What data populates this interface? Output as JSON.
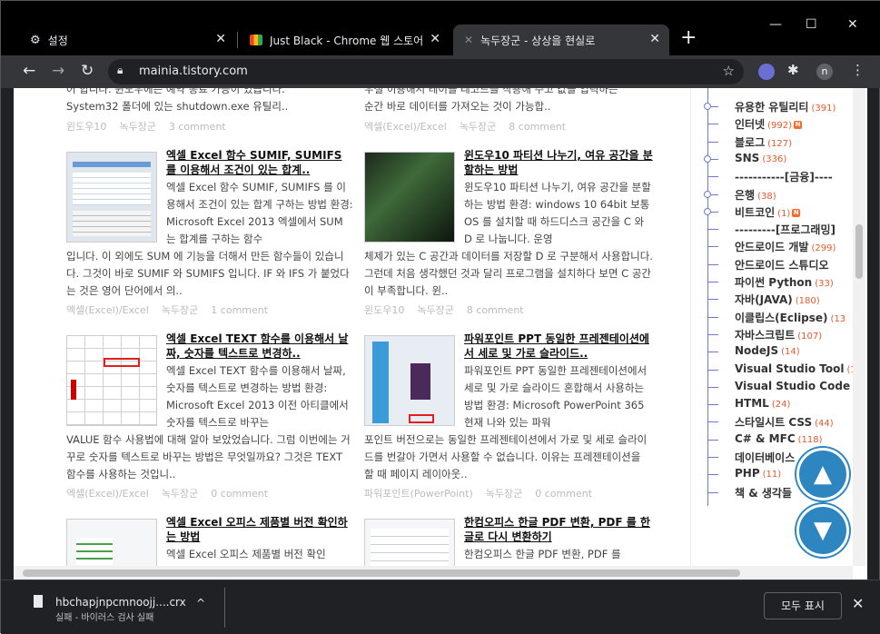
{
  "tabs": [
    {
      "title": "설정",
      "icon": "gear-icon"
    },
    {
      "title": "Just Black - Chrome 웹 스토어",
      "icon": "webstore-icon"
    },
    {
      "title": "녹두장군 - 상상을 현실로",
      "icon": "blog-icon"
    }
  ],
  "newtab_glyph": "+",
  "window_controls": {
    "minimize": "—",
    "maximize": "☐",
    "close": "✕"
  },
  "toolbar": {
    "back": "←",
    "forward": "→",
    "reload": "↻",
    "url": "mainia.tistory.com",
    "star": "☆",
    "profile_initial": "n",
    "menu": "⋮"
  },
  "content": {
    "top_left_line1": "어 합니다. 윈도우에는 예약 종료 가능이 있습니다.",
    "top_left_line2": "System32 폴더에 있는 shutdown.exe 유틸리..",
    "top_left_meta": [
      "윈도우10",
      "녹두장군",
      "3 comment"
    ],
    "top_right_line1": "우절 이용해서 테이블 레코드를 작용해 주고 값을 입력하는",
    "top_right_line2": "순간 바로 데이터를 가져오는 것이 가능합..",
    "top_right_meta": [
      "엑셀(Excel)/Excel",
      "녹두장군",
      "8 comment"
    ],
    "posts": [
      {
        "title": "엑셀 Excel 함수 SUMIF, SUMIFS 를 이용해서 조건이 있는 합계..",
        "body": "엑셀 Excel 함수 SUMIF, SUMIFS 를 이용해서 조건이 있는 합계 구하는 방법 환경: Microsoft Excel 2013 엑셀에서 SUM 는 합계를 구하는 함수",
        "body_wide": "입니다. 이 외에도 SUM 에 기능을 더해서 만든 함수들이 있습니다. 그것이 바로 SUMIF 와 SUMIFS 입니다. IF 와 IFS 가 붙었다는 것은 영어 단어에서 의..",
        "meta": [
          "엑셀(Excel)/Excel",
          "녹두장군",
          "1 comment"
        ]
      },
      {
        "title": "윈도우10 파티션 나누기, 여유 공간을 분할하는 방법",
        "body": "윈도우10 파티션 나누기, 여유 공간을 분할하는 방법 환경: windows 10 64bit 보통 OS 를 설치할 때 하드디스크 공간을 C 와 D 로 나눕니다. 운영",
        "body_wide": "체제가 있는 C 공간과 데이터를 저장할 D 로 구분해서 사용합니다. 그런데 처음 생각했던 것과 달리 프로그램을 설치하다 보면 C 공간이 부족합니다. 윈..",
        "meta": [
          "윈도우10",
          "녹두장군",
          "8 comment"
        ]
      },
      {
        "title": "엑셀 Excel TEXT 함수를 이용해서 날짜, 숫자를 텍스트로 변경하..",
        "body": "엑셀 Excel TEXT 함수를 이용해서 날짜, 숫자를 텍스트로 변경하는 방법 환경: Microsoft Excel 2013 이전 아티클에서 숫자를 텍스트로 바꾸는",
        "body_wide": "VALUE 함수 사용법에 대해 알아 보았었습니다. 그럼 이번에는 거꾸로 숫자를 텍스트로 바꾸는 방법은 무엇일까요? 그것은 TEXT 함수를 사용하는 것입니..",
        "meta": [
          "엑셀(Excel)/Excel",
          "녹두장군",
          "0 comment"
        ]
      },
      {
        "title": "파워포인트 PPT 동일한 프레젠테이션에서 세로 및 가로 슬라이드..",
        "body": "파워포인트 PPT 동일한 프레젠테이션에서 세로 및 가로 슬라이드 혼합해서 사용하는 방법 환경: Microsoft PowerPoint 365 현재 나와 있는 파워",
        "body_wide": "포인트 버전으로는 동일한 프레젠테이션에서 가로 및 세로 슬라이드를 번갈아 가면서 사용할 수 없습니다. 이유는 프레젠테이션을 할 때 페이지 레이아웃..",
        "meta": [
          "파워포인트(PowerPoint)",
          "녹두장군",
          "0 comment"
        ]
      },
      {
        "title": "엑셀 Excel 오피스 제품별 버전 확인하는 방법",
        "body": "엑셀 Excel 오피스 제품별 버전 확인",
        "body_wide": "",
        "meta": []
      },
      {
        "title": "한컴오피스 한글 PDF 변환, PDF 를 한글로 다시 변환하기",
        "body": "한컴오피스 한글 PDF 변환, PDF 를",
        "body_wide": "",
        "meta": []
      }
    ]
  },
  "sidebar": {
    "items": [
      {
        "label": "유용한 유틸리티",
        "count": "(391)",
        "new": false
      },
      {
        "label": "인터넷",
        "count": "(992)",
        "new": true
      },
      {
        "label": "블로그",
        "count": "(127)",
        "new": false
      },
      {
        "label": "SNS",
        "count": "(336)",
        "new": false
      },
      {
        "label": "-----------[금융]----",
        "count": "",
        "new": false
      },
      {
        "label": "은행",
        "count": "(38)",
        "new": false
      },
      {
        "label": "비트코인",
        "count": "(1)",
        "new": true
      },
      {
        "label": "---------[프로그래밍]",
        "count": "",
        "new": false
      },
      {
        "label": "안드로이드 개발",
        "count": "(299)",
        "new": false
      },
      {
        "label": "안드로이드 스튜디오",
        "count": "",
        "new": false
      },
      {
        "label": "파이썬 Python",
        "count": "(33)",
        "new": false
      },
      {
        "label": "자바(JAVA)",
        "count": "(180)",
        "new": false
      },
      {
        "label": "이클립스(Eclipse)",
        "count": "(13",
        "new": false
      },
      {
        "label": "자바스크립트",
        "count": "(107)",
        "new": false
      },
      {
        "label": "NodeJS",
        "count": "(14)",
        "new": false
      },
      {
        "label": "Visual Studio Tool",
        "count": "(1",
        "new": false
      },
      {
        "label": "Visual Studio Code",
        "count": "(",
        "new": false
      },
      {
        "label": "HTML",
        "count": "(24)",
        "new": false
      },
      {
        "label": "스타일시트 CSS",
        "count": "(44)",
        "new": false
      },
      {
        "label": "C# & MFC",
        "count": "(118)",
        "new": false
      },
      {
        "label": "데이터베이스",
        "count": "",
        "new": false
      },
      {
        "label": "PHP",
        "count": "(11)",
        "new": false
      },
      {
        "label": "책 & 생각들",
        "count": "",
        "new": false
      }
    ],
    "new_badge": "N"
  },
  "scroll_buttons": {
    "up": "▲",
    "down": "▼"
  },
  "download": {
    "filename": "hbchapjnpcmnoojj....crx",
    "status": "실패 - 바이러스 검사 실패",
    "chevron": "^",
    "show_all": "모두 표시",
    "close": "✕"
  }
}
